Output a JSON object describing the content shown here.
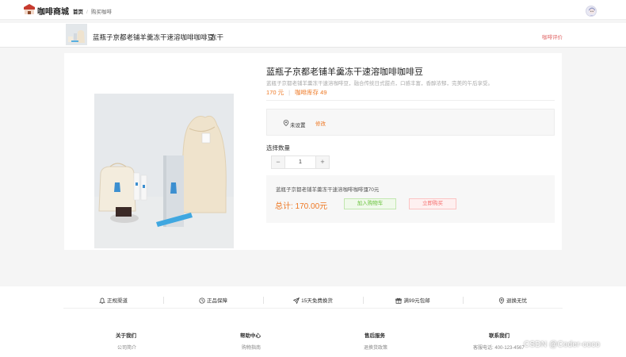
{
  "header": {
    "brand": "咖啡商城",
    "breadcrumb": {
      "home": "首页",
      "separator": "/",
      "current": "购买咖啡"
    }
  },
  "product_bar": {
    "title": "蓝瓶子京都老铺羊羹冻干速溶咖啡咖啡豆",
    "tag": "冻干",
    "review_link": "咖啡评价"
  },
  "product": {
    "title": "蓝瓶子京都老铺羊羹冻干速溶咖啡咖啡豆",
    "description": "蓝瓶子京都老铺羊羹冻干速溶咖啡豆，融合传统日式甜点，口感丰富，香醇浓郁，完美的午后享受。",
    "price": "170 元",
    "stock": "咖啡库存 49"
  },
  "address": {
    "text": "未设置",
    "edit_label": "修改"
  },
  "quantity": {
    "label": "选择数量",
    "value": "1",
    "minus": "−",
    "plus": "+"
  },
  "summary": {
    "name": "蓝瓶子京都老铺羊羹冻干速溶咖啡咖啡豆",
    "price": "170元",
    "total": "总计:  170.00元",
    "add_to_cart": "加入购物车",
    "buy_now": "立即购买"
  },
  "services": [
    "正规渠道",
    "正品保障",
    "15天免费换货",
    "满99元包邮",
    "退换无忧"
  ],
  "footer_columns": [
    {
      "title": "关于我们",
      "item": "公司简介"
    },
    {
      "title": "帮助中心",
      "item": "购物指南"
    },
    {
      "title": "售后服务",
      "item": "退换货政策"
    },
    {
      "title": "联系我们",
      "item": "客服电话: 400-123-4567"
    }
  ],
  "watermark": "CSDN @Coder-coco",
  "colors": {
    "accent": "#ee7722",
    "cart": "#67c23a",
    "buy": "#f56c6c",
    "review": "#e06666"
  },
  "icons": [
    "bell-icon",
    "clock-icon",
    "send-icon",
    "gift-icon",
    "location-icon"
  ]
}
